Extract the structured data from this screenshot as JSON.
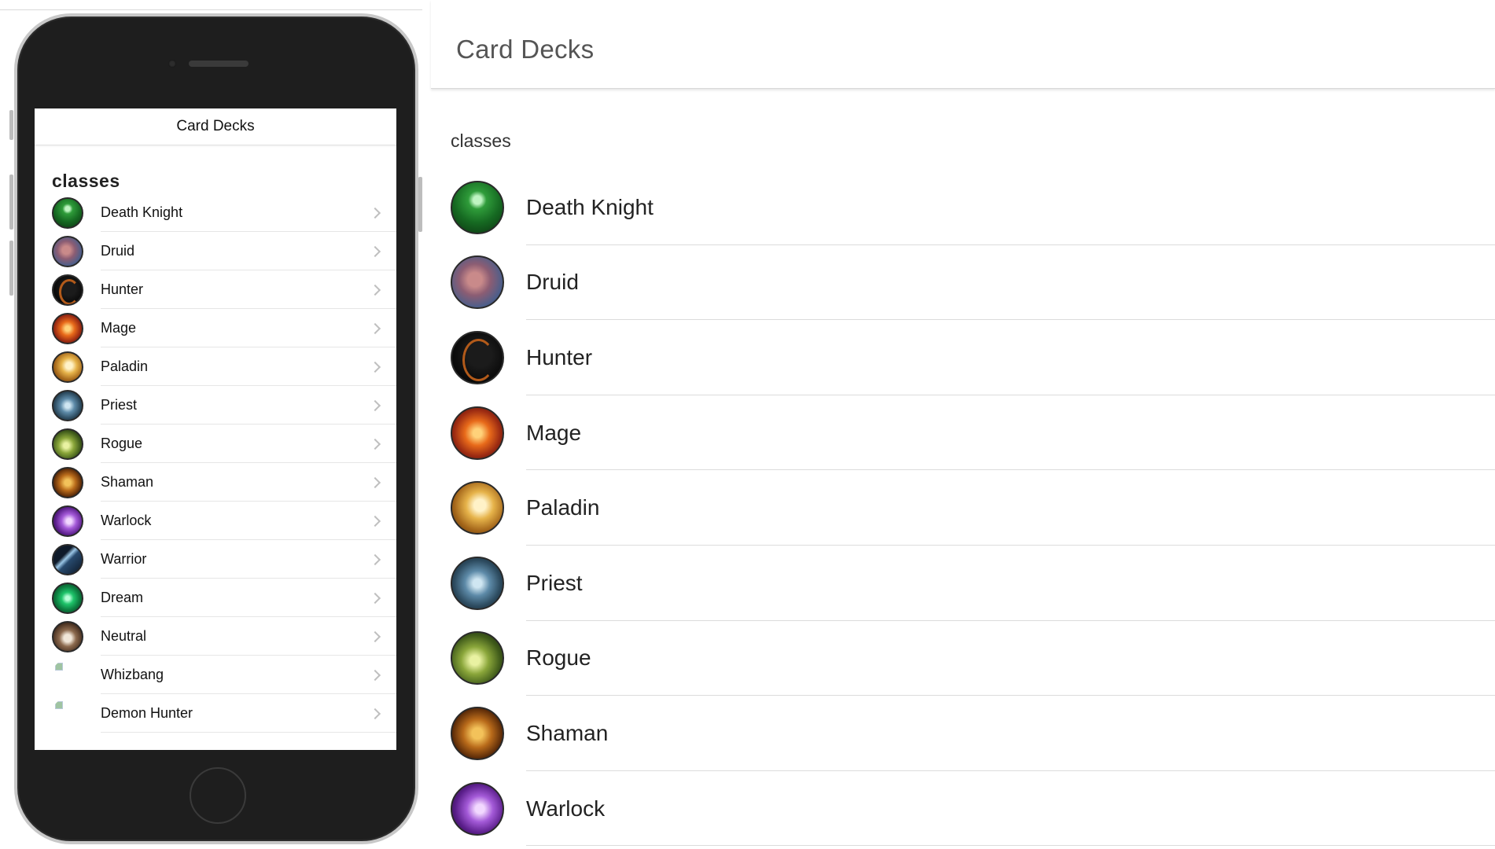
{
  "app": {
    "title": "Card Decks"
  },
  "mobile": {
    "header_title": "Card Decks",
    "section_label": "classes",
    "items": [
      {
        "label": "Death Knight",
        "icon": "death-knight-icon"
      },
      {
        "label": "Druid",
        "icon": "druid-icon"
      },
      {
        "label": "Hunter",
        "icon": "hunter-icon"
      },
      {
        "label": "Mage",
        "icon": "mage-icon"
      },
      {
        "label": "Paladin",
        "icon": "paladin-icon"
      },
      {
        "label": "Priest",
        "icon": "priest-icon"
      },
      {
        "label": "Rogue",
        "icon": "rogue-icon"
      },
      {
        "label": "Shaman",
        "icon": "shaman-icon"
      },
      {
        "label": "Warlock",
        "icon": "warlock-icon"
      },
      {
        "label": "Warrior",
        "icon": "warrior-icon"
      },
      {
        "label": "Dream",
        "icon": "dream-icon"
      },
      {
        "label": "Neutral",
        "icon": "neutral-icon"
      },
      {
        "label": "Whizbang",
        "icon": "broken-image-icon"
      },
      {
        "label": "Demon Hunter",
        "icon": "broken-image-icon"
      }
    ]
  },
  "desktop": {
    "header_title": "Card Decks",
    "section_label": "classes",
    "items": [
      {
        "label": "Death Knight",
        "icon": "death-knight-icon"
      },
      {
        "label": "Druid",
        "icon": "druid-icon"
      },
      {
        "label": "Hunter",
        "icon": "hunter-icon"
      },
      {
        "label": "Mage",
        "icon": "mage-icon"
      },
      {
        "label": "Paladin",
        "icon": "paladin-icon"
      },
      {
        "label": "Priest",
        "icon": "priest-icon"
      },
      {
        "label": "Rogue",
        "icon": "rogue-icon"
      },
      {
        "label": "Shaman",
        "icon": "shaman-icon"
      },
      {
        "label": "Warlock",
        "icon": "warlock-icon"
      }
    ]
  },
  "colors": {
    "header_title_text": "#555555",
    "divider": "#dcdcdc",
    "phone_body": "#1e1e1e",
    "phone_bezel": "#c8c8c8",
    "chevron": "#bfbfbf"
  }
}
